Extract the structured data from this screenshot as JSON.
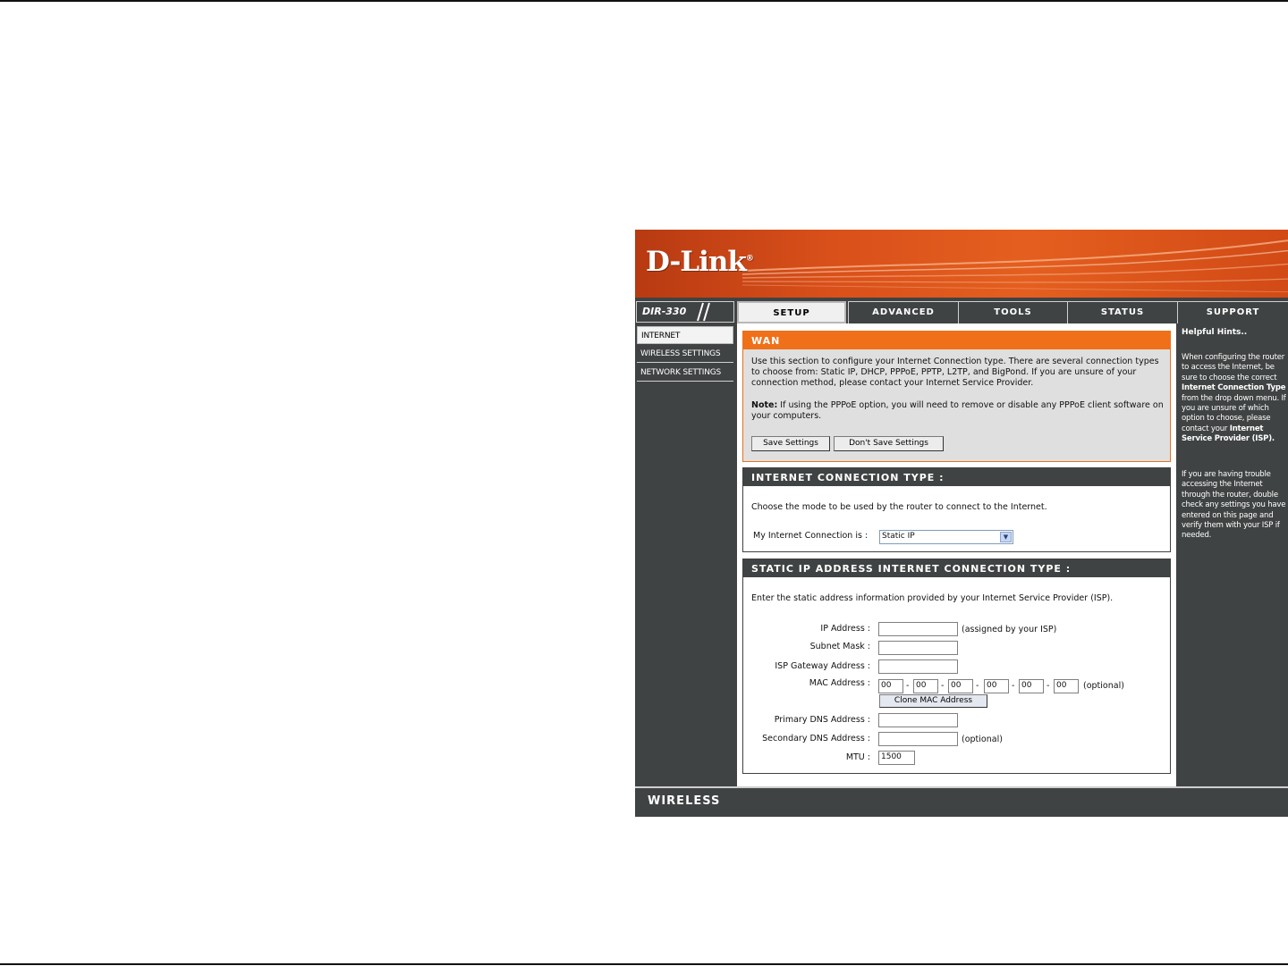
{
  "brand": {
    "logo": "D-Link",
    "model": "DIR-330",
    "footer": "WIRELESS"
  },
  "tabs": [
    {
      "label": "SETUP",
      "active": true
    },
    {
      "label": "ADVANCED",
      "active": false
    },
    {
      "label": "TOOLS",
      "active": false
    },
    {
      "label": "STATUS",
      "active": false
    },
    {
      "label": "SUPPORT",
      "active": false
    }
  ],
  "sidebar": {
    "items": [
      {
        "label": "INTERNET",
        "active": true
      },
      {
        "label": "WIRELESS SETTINGS",
        "active": false
      },
      {
        "label": "NETWORK SETTINGS",
        "active": false
      }
    ]
  },
  "wan": {
    "title": "WAN",
    "description": "Use this section to configure your Internet Connection type. There are several connection types to choose from: Static IP, DHCP, PPPoE, PPTP, L2TP, and BigPond. If you are unsure of your connection method, please contact your Internet Service Provider.",
    "note_label": "Note:",
    "note_text": " If using the PPPoE option, you will need to remove or disable any PPPoE client software on your computers.",
    "save_label": "Save Settings",
    "dont_save_label": "Don't Save Settings"
  },
  "connection_type": {
    "title": "INTERNET CONNECTION TYPE :",
    "description": "Choose the mode to be used by the router to connect to the Internet.",
    "select_label": "My Internet Connection is :",
    "selected": "Static IP"
  },
  "static_ip": {
    "title": "STATIC IP ADDRESS INTERNET CONNECTION TYPE :",
    "description": "Enter the static address information provided by your Internet Service Provider (ISP).",
    "ip_label": "IP Address :",
    "ip_value": "",
    "ip_hint": "(assigned by your ISP)",
    "subnet_label": "Subnet Mask :",
    "subnet_value": "",
    "gateway_label": "ISP Gateway Address :",
    "gateway_value": "",
    "mac_label": "MAC Address :",
    "mac_octets": [
      "00",
      "00",
      "00",
      "00",
      "00",
      "00"
    ],
    "mac_separator": "-",
    "mac_hint": "(optional)",
    "clone_label": "Clone MAC Address",
    "dns1_label": "Primary DNS Address :",
    "dns1_value": "",
    "dns2_label": "Secondary DNS Address :",
    "dns2_value": "",
    "dns2_hint": "(optional)",
    "mtu_label": "MTU :",
    "mtu_value": "1500"
  },
  "hints": {
    "title": "Helpful Hints..",
    "p1_a": "When configuring the router to access the Internet, be sure to choose the correct ",
    "p1_b": "Internet Connection Type",
    "p1_c": " from the drop down menu. If you are unsure of which option to choose, please contact your ",
    "p1_d": "Internet Service Provider (ISP).",
    "p2": "If you are having trouble accessing the Internet through the router, double check any settings you have entered on this page and verify them with your ISP if needed."
  }
}
